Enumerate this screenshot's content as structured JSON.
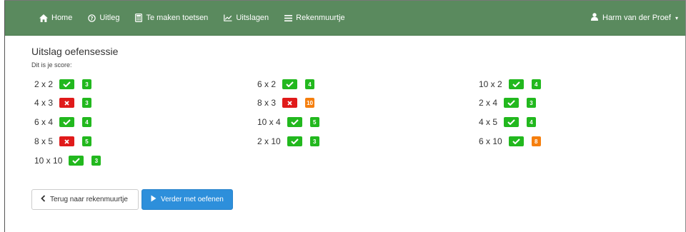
{
  "navbar": {
    "items": [
      {
        "label": "Home",
        "icon": "home-icon"
      },
      {
        "label": "Uitleg",
        "icon": "question-circle-icon"
      },
      {
        "label": "Te maken toetsen",
        "icon": "calculator-icon"
      },
      {
        "label": "Uitslagen",
        "icon": "line-chart-icon"
      },
      {
        "label": "Rekenmuurtje",
        "icon": "bars-icon"
      }
    ],
    "user": {
      "name": "Harm van der Proef",
      "icon": "user-icon"
    },
    "background": "#5a8a5e"
  },
  "page": {
    "title": "Uitslag oefensessie",
    "subtitle": "Dit is je score:"
  },
  "results": {
    "columns": [
      [
        {
          "question": "2 x 2",
          "correct": true,
          "score": "3",
          "score_color": "green"
        },
        {
          "question": "4 x 3",
          "correct": false,
          "score": "3",
          "score_color": "green"
        },
        {
          "question": "6 x 4",
          "correct": true,
          "score": "4",
          "score_color": "green"
        },
        {
          "question": "8 x 5",
          "correct": false,
          "score": "5",
          "score_color": "green"
        },
        {
          "question": "10 x 10",
          "correct": true,
          "score": "3",
          "score_color": "green"
        }
      ],
      [
        {
          "question": "6 x 2",
          "correct": true,
          "score": "4",
          "score_color": "green"
        },
        {
          "question": "8 x 3",
          "correct": false,
          "score": "10",
          "score_color": "orange"
        },
        {
          "question": "10 x 4",
          "correct": true,
          "score": "5",
          "score_color": "green"
        },
        {
          "question": "2 x 10",
          "correct": true,
          "score": "3",
          "score_color": "green"
        }
      ],
      [
        {
          "question": "10 x 2",
          "correct": true,
          "score": "4",
          "score_color": "green"
        },
        {
          "question": "2 x 4",
          "correct": true,
          "score": "3",
          "score_color": "green"
        },
        {
          "question": "4 x 5",
          "correct": true,
          "score": "4",
          "score_color": "green"
        },
        {
          "question": "6 x 10",
          "correct": true,
          "score": "8",
          "score_color": "orange"
        }
      ]
    ],
    "colors": {
      "correct": "#22b81e",
      "wrong": "#e01a1a",
      "score_green": "#22b81e",
      "score_orange": "#f57f0e"
    }
  },
  "buttons": {
    "back": {
      "label": "Terug naar rekenmuurtje",
      "icon": "chevron-left-icon"
    },
    "continue": {
      "label": "Verder met oefenen",
      "icon": "play-icon",
      "color": "#2d8fdb"
    }
  }
}
